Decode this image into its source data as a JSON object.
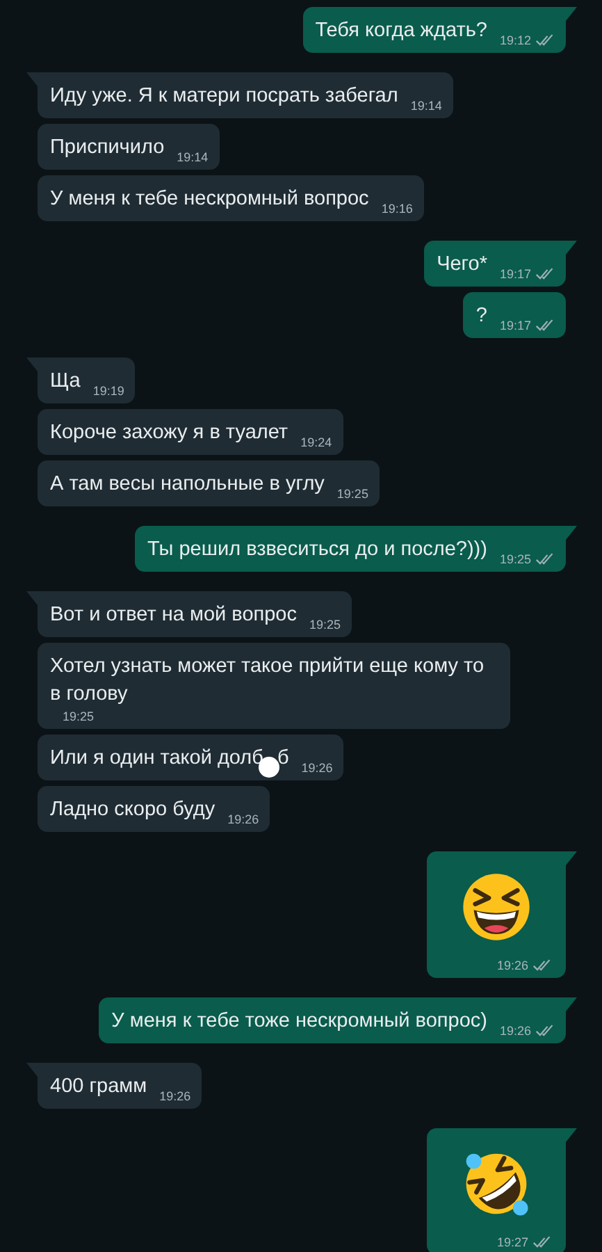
{
  "messages": [
    {
      "outgoing": true,
      "tail": true,
      "kind": "text",
      "text": "Тебя когда ждать?",
      "time": "19:12",
      "delivered": true
    },
    {
      "outgoing": false,
      "tail": true,
      "kind": "text",
      "text": "Иду уже. Я к матери посрать забегал",
      "time": "19:14"
    },
    {
      "outgoing": false,
      "tail": false,
      "kind": "text",
      "text": "Приспичило",
      "time": "19:14"
    },
    {
      "outgoing": false,
      "tail": false,
      "kind": "text",
      "text": "У меня к тебе нескромный вопрос",
      "time": "19:16"
    },
    {
      "outgoing": true,
      "tail": true,
      "kind": "text",
      "text": "Чего*",
      "time": "19:17",
      "delivered": true
    },
    {
      "outgoing": true,
      "tail": false,
      "kind": "text",
      "text": "?",
      "time": "19:17",
      "delivered": true
    },
    {
      "outgoing": false,
      "tail": true,
      "kind": "text",
      "text": "Ща",
      "time": "19:19"
    },
    {
      "outgoing": false,
      "tail": false,
      "kind": "text",
      "text": "Короче захожу я в туалет",
      "time": "19:24"
    },
    {
      "outgoing": false,
      "tail": false,
      "kind": "text",
      "text": "А там весы напольные в углу",
      "time": "19:25"
    },
    {
      "outgoing": true,
      "tail": true,
      "kind": "text",
      "text": "Ты решил взвеситься до и после?)))",
      "time": "19:25",
      "delivered": true
    },
    {
      "outgoing": false,
      "tail": true,
      "kind": "text",
      "text": "Вот и ответ на мой вопрос",
      "time": "19:25"
    },
    {
      "outgoing": false,
      "tail": false,
      "kind": "text",
      "text": "Хотел узнать может такое прийти еще кому то в голову",
      "time": "19:25"
    },
    {
      "outgoing": false,
      "tail": false,
      "kind": "censored",
      "text": "Или я один такой долб",
      "text_after": "б",
      "time": "19:26"
    },
    {
      "outgoing": false,
      "tail": false,
      "kind": "text",
      "text": "Ладно скоро буду",
      "time": "19:26"
    },
    {
      "outgoing": true,
      "tail": true,
      "kind": "grin",
      "time": "19:26",
      "delivered": true
    },
    {
      "outgoing": true,
      "tail": true,
      "kind": "text",
      "text": "У меня к тебе тоже нескромный вопрос)",
      "time": "19:26",
      "delivered": true
    },
    {
      "outgoing": false,
      "tail": true,
      "kind": "text",
      "text": "400 грамм",
      "time": "19:26"
    },
    {
      "outgoing": true,
      "tail": true,
      "kind": "rofl",
      "time": "19:27",
      "delivered": true
    }
  ]
}
